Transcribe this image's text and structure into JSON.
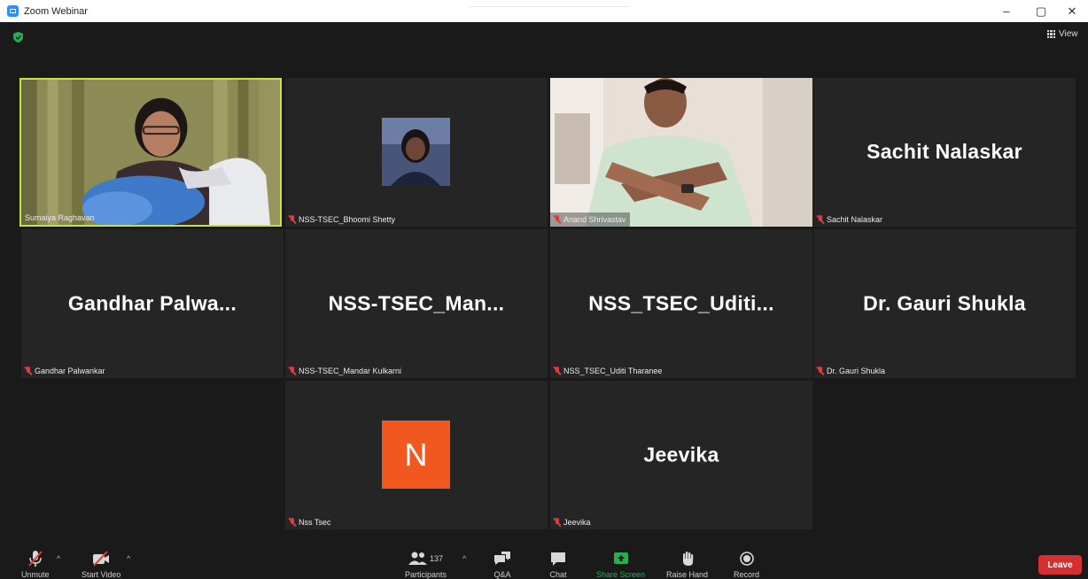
{
  "window": {
    "title": "Zoom Webinar",
    "controls": [
      "–",
      "▢",
      "✕"
    ]
  },
  "top": {
    "view_label": "View"
  },
  "tiles": [
    {
      "name": "Sumaiya Raghavan",
      "type": "video",
      "active": true
    },
    {
      "name": "NSS-TSEC_Bhoomi Shetty",
      "type": "avatar"
    },
    {
      "name": "Anand Shrivastav",
      "type": "video"
    },
    {
      "name": "Sachit Nalaskar",
      "display": "Sachit Nalaskar",
      "type": "name"
    },
    {
      "name": "Gandhar Palwankar",
      "display": "Gandhar  Palwa...",
      "type": "name"
    },
    {
      "name": "NSS-TSEC_Mandar Kulkarni",
      "display": "NSS-TSEC_Man...",
      "type": "name"
    },
    {
      "name": "NSS_TSEC_Uditi Tharanee",
      "display": "NSS_TSEC_Uditi...",
      "type": "name"
    },
    {
      "name": "Dr. Gauri Shukla",
      "display": "Dr. Gauri Shukla",
      "type": "name"
    },
    {
      "name": "Nss Tsec",
      "initial": "N",
      "type": "initial"
    },
    {
      "name": "Jeevika",
      "display": "Jeevika",
      "type": "name"
    }
  ],
  "toolbar": {
    "unmute": "Unmute",
    "start_video": "Start Video",
    "participants": "Participants",
    "participants_count": "137",
    "qa": "Q&A",
    "chat": "Chat",
    "share_screen": "Share Screen",
    "raise_hand": "Raise Hand",
    "record": "Record",
    "leave": "Leave"
  },
  "colors": {
    "active_border": "#c8e04a",
    "leave": "#d62f2f",
    "share": "#23b052",
    "avatar_n": "#f0581f",
    "zoom_blue": "#2d8cff"
  }
}
